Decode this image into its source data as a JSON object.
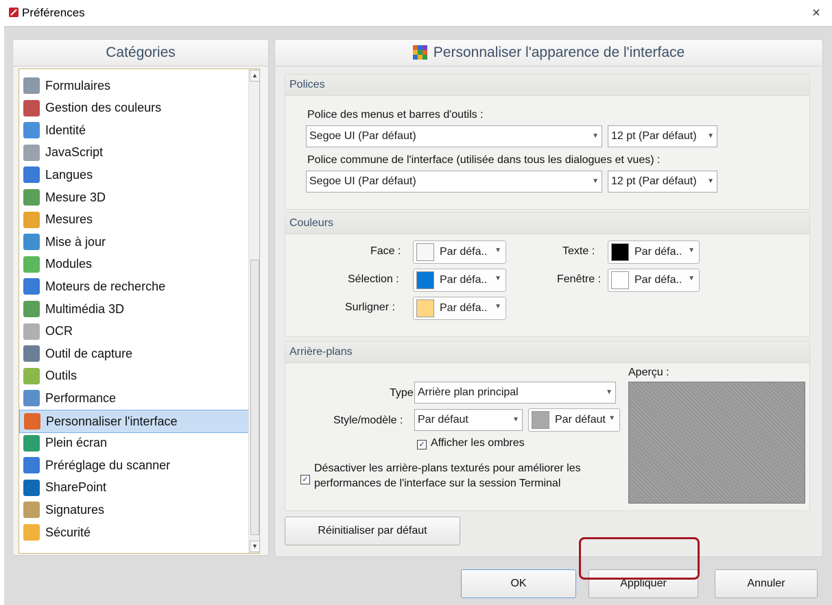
{
  "window": {
    "title": "Préférences",
    "close_glyph": "×"
  },
  "categories": {
    "header": "Catégories",
    "items": [
      {
        "label": "Formulaires",
        "icon": "forms-icon",
        "color": "#8a98a8"
      },
      {
        "label": "Gestion des couleurs",
        "icon": "color-management-icon",
        "color": "#c0504d"
      },
      {
        "label": "Identité",
        "icon": "identity-icon",
        "color": "#4a90d9"
      },
      {
        "label": "JavaScript",
        "icon": "javascript-icon",
        "color": "#9aa3ad"
      },
      {
        "label": "Langues",
        "icon": "languages-icon",
        "color": "#3a7bd5"
      },
      {
        "label": "Mesure 3D",
        "icon": "measure-3d-icon",
        "color": "#5aa05a"
      },
      {
        "label": "Mesures",
        "icon": "measurements-icon",
        "color": "#e7a430"
      },
      {
        "label": "Mise à jour",
        "icon": "update-icon",
        "color": "#3f8fd0"
      },
      {
        "label": "Modules",
        "icon": "modules-icon",
        "color": "#5cb85c"
      },
      {
        "label": "Moteurs de recherche",
        "icon": "search-engines-icon",
        "color": "#3a7bd5"
      },
      {
        "label": "Multimédia 3D",
        "icon": "multimedia-3d-icon",
        "color": "#5aa05a"
      },
      {
        "label": "OCR",
        "icon": "ocr-icon",
        "color": "#b0b0b0"
      },
      {
        "label": "Outil de capture",
        "icon": "capture-tool-icon",
        "color": "#6a7f96"
      },
      {
        "label": "Outils",
        "icon": "tools-icon",
        "color": "#8bb84a"
      },
      {
        "label": "Performance",
        "icon": "performance-icon",
        "color": "#5b8fc9"
      },
      {
        "label": "Personnaliser l'interface",
        "icon": "customize-interface-icon",
        "color": "#e0662b"
      },
      {
        "label": "Plein écran",
        "icon": "fullscreen-icon",
        "color": "#2e9e6e"
      },
      {
        "label": "Préréglage du scanner",
        "icon": "scanner-preset-icon",
        "color": "#3a7bd5"
      },
      {
        "label": "SharePoint",
        "icon": "sharepoint-icon",
        "color": "#0f6ab3"
      },
      {
        "label": "Signatures",
        "icon": "signatures-icon",
        "color": "#c0a060"
      },
      {
        "label": "Sécurité",
        "icon": "security-icon",
        "color": "#f0b23a"
      }
    ],
    "selected_label": "Personnaliser l'interface"
  },
  "main": {
    "header": "Personnaliser l'apparence de l'interface",
    "polices": {
      "title": "Polices",
      "menu_font_label": "Police des menus et barres d'outils :",
      "menu_font_value": "Segoe UI (Par défaut)",
      "menu_size_value": "12 pt (Par défaut)",
      "common_font_label": "Police commune de l'interface (utilisée dans tous les dialogues et vues) :",
      "common_font_value": "Segoe UI (Par défaut)",
      "common_size_value": "12 pt (Par défaut)"
    },
    "couleurs": {
      "title": "Couleurs",
      "face_label": "Face :",
      "face_value": "Par défa..",
      "face_color": "#f7f7f7",
      "selection_label": "Sélection :",
      "selection_value": "Par défa..",
      "selection_color": "#0a78d7",
      "surligner_label": "Surligner :",
      "surligner_value": "Par défa..",
      "surligner_color": "#ffd780",
      "texte_label": "Texte :",
      "texte_value": "Par défa..",
      "texte_color": "#000000",
      "fenetre_label": "Fenêtre :",
      "fenetre_value": "Par défa..",
      "fenetre_color": "#ffffff"
    },
    "arriere_plans": {
      "title": "Arrière-plans",
      "type_label": "Type",
      "type_value": "Arrière plan principal",
      "style_label": "Style/modèle :",
      "style_value": "Par défaut",
      "style_color_value": "Par défaut",
      "style_color": "#a8a8a8",
      "shadows_label": "Afficher les ombres",
      "shadows_checked": true,
      "disable_textured_label_line1": "Désactiver les arrière-plans texturés pour améliorer les",
      "disable_textured_label_line2": "performances de l'interface sur la session Terminal",
      "disable_textured_checked": true,
      "preview_label": "Aperçu :"
    },
    "reset_button": "Réinitialiser par défaut"
  },
  "footer": {
    "ok": "OK",
    "apply": "Appliquer",
    "cancel": "Annuler"
  }
}
